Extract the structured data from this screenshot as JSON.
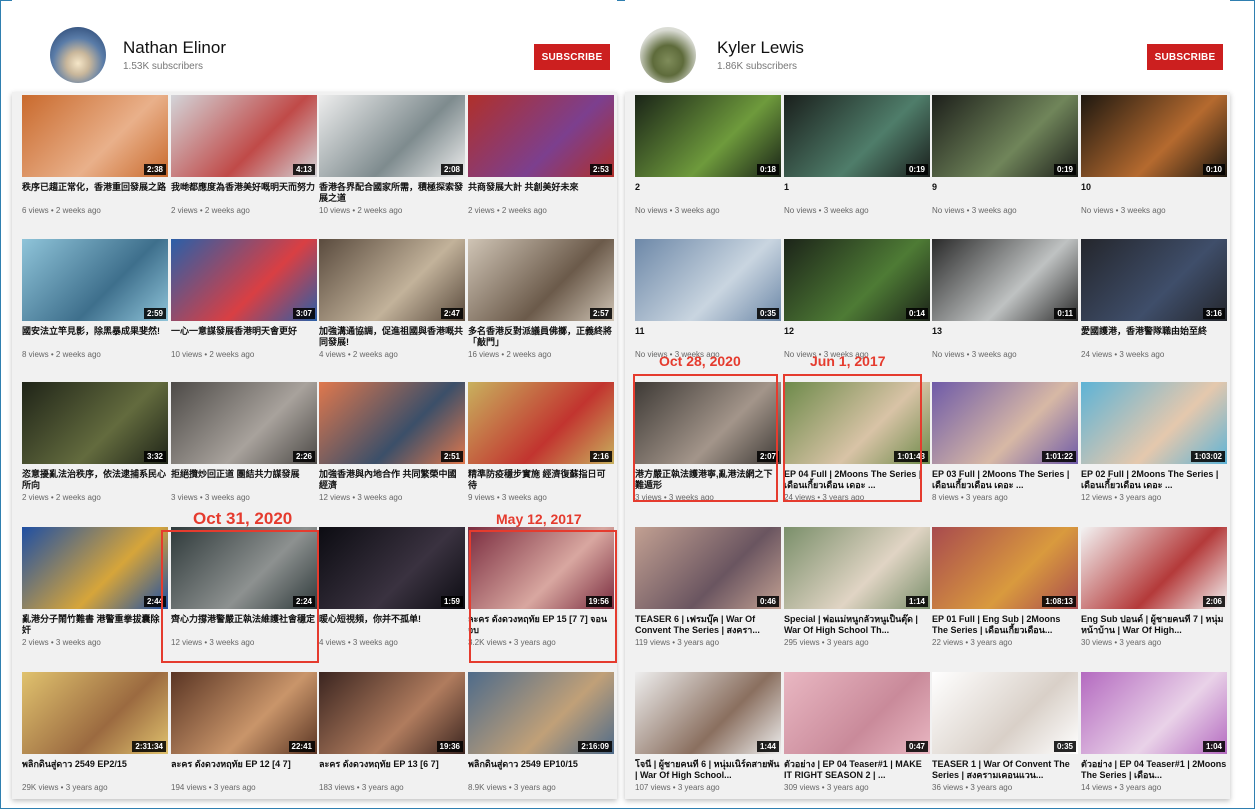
{
  "channels": [
    {
      "name": "Nathan Elinor",
      "subscribers": "1.53K subscribers",
      "subscribe_label": "SUBSCRIBE",
      "videos": [
        {
          "title": "秩序已趨正常化，香港重回發展之路",
          "meta": "6 views • 2 weeks ago",
          "duration": "2:38",
          "colors": [
            "#c96a2d",
            "#e9b08a"
          ]
        },
        {
          "title": "我哋都應度為香港美好嘅明天而努力",
          "meta": "2 views • 2 weeks ago",
          "duration": "4:13",
          "colors": [
            "#d3d4d8",
            "#c04a48"
          ]
        },
        {
          "title": "香港各界配合國家所需，積極探索發展之道",
          "meta": "10 views • 2 weeks ago",
          "duration": "2:08",
          "colors": [
            "#ededed",
            "#7e8b8e"
          ]
        },
        {
          "title": "共商發展大計 共創美好未來",
          "meta": "2 views • 2 weeks ago",
          "duration": "2:53",
          "colors": [
            "#b0302a",
            "#7c3f8e"
          ]
        },
        {
          "title": "國安法立竿見影，除黑暴成果斐然!",
          "meta": "8 views • 2 weeks ago",
          "duration": "2:59",
          "colors": [
            "#8fc4d9",
            "#3e6f8c"
          ]
        },
        {
          "title": "一心一意謀發展香港明天會更好",
          "meta": "10 views • 2 weeks ago",
          "duration": "3:07",
          "colors": [
            "#2a5fa8",
            "#d93f43"
          ]
        },
        {
          "title": "加強溝通協調，促進祖國與香港嘅共同發展!",
          "meta": "4 views • 2 weeks ago",
          "duration": "2:47",
          "colors": [
            "#5a4b3e",
            "#c2b29a"
          ]
        },
        {
          "title": "多名香港反對派議員佛擲，正義終將「敲門」",
          "meta": "16 views • 2 weeks ago",
          "duration": "2:57",
          "colors": [
            "#cfc4b5",
            "#6b5a4a"
          ]
        },
        {
          "title": "恣意擾亂法治秩序，依法逮捕系民心所向",
          "meta": "2 views • 2 weeks ago",
          "duration": "3:32",
          "colors": [
            "#1f2418",
            "#636b3e"
          ]
        },
        {
          "title": "拒絕攬炒回正道 團結共力謀發展",
          "meta": "3 views • 3 weeks ago",
          "duration": "2:26",
          "colors": [
            "#4d4a47",
            "#a8a29c"
          ]
        },
        {
          "title": "加強香港與內地合作 共同繁榮中國經濟",
          "meta": "12 views • 3 weeks ago",
          "duration": "2:51",
          "colors": [
            "#e0784d",
            "#3b4f69"
          ]
        },
        {
          "title": "精準防疫穩步實施 經濟復蘇指日可待",
          "meta": "9 views • 3 weeks ago",
          "duration": "2:16",
          "colors": [
            "#c8b15e",
            "#c2342f"
          ]
        },
        {
          "title": "亂港分子鬧竹難書 港警重拳拔囊除奸",
          "meta": "2 views • 3 weeks ago",
          "duration": "2:44",
          "colors": [
            "#1f4fa3",
            "#d6a53a"
          ]
        },
        {
          "title": "齊心力撐港警嚴正執法維護社會穩定",
          "meta": "12 views • 3 weeks ago",
          "duration": "2:24",
          "colors": [
            "#2f3a3b",
            "#8d9190"
          ]
        },
        {
          "title": "暖心短視頻，你并不孤单!",
          "meta": "4 views • 3 weeks ago",
          "duration": "1:59",
          "colors": [
            "#0c0c12",
            "#3a3240"
          ]
        },
        {
          "title": "ละคร ดั่งดวงหฤทัย EP 15 [7 7] จอนจบ",
          "meta": "3.2K views • 3 years ago",
          "duration": "19:56",
          "colors": [
            "#7a2c3f",
            "#d8a7a0"
          ]
        },
        {
          "title": "พลิกดินสู่ดาว 2549 EP2/15",
          "meta": "29K views • 3 years ago",
          "duration": "2:31:34",
          "colors": [
            "#e0c26e",
            "#9b6a40"
          ]
        },
        {
          "title": "ละคร ดั่งดวงหฤทัย EP 12 [4 7]",
          "meta": "194 views • 3 years ago",
          "duration": "22:41",
          "colors": [
            "#5a3524",
            "#c9956a"
          ]
        },
        {
          "title": "ละคร ดั่งดวงหฤทัย EP 13 [6 7]",
          "meta": "183 views • 3 years ago",
          "duration": "19:36",
          "colors": [
            "#3b2520",
            "#b07c5e"
          ]
        },
        {
          "title": "พลิกดินสู่ดาว 2549 EP10/15",
          "meta": "8.9K views • 3 years ago",
          "duration": "2:16:09",
          "colors": [
            "#4e6b8a",
            "#c0a078"
          ]
        }
      ]
    },
    {
      "name": "Kyler Lewis",
      "subscribers": "1.86K subscribers",
      "subscribe_label": "SUBSCRIBE",
      "videos": [
        {
          "title": "2",
          "meta": "No views • 3 weeks ago",
          "duration": "0:18",
          "colors": [
            "#1a2418",
            "#6e9a3c"
          ]
        },
        {
          "title": "1",
          "meta": "No views • 3 weeks ago",
          "duration": "0:19",
          "colors": [
            "#1a1f1c",
            "#4f7d6a"
          ]
        },
        {
          "title": "9",
          "meta": "No views • 3 weeks ago",
          "duration": "0:19",
          "colors": [
            "#1d1f1b",
            "#70855a"
          ]
        },
        {
          "title": "10",
          "meta": "No views • 3 weeks ago",
          "duration": "0:10",
          "colors": [
            "#1e1810",
            "#b56a2f"
          ]
        },
        {
          "title": "11",
          "meta": "No views • 3 weeks ago",
          "duration": "0:35",
          "colors": [
            "#6d88a8",
            "#c9d5e0"
          ]
        },
        {
          "title": "12",
          "meta": "No views • 3 weeks ago",
          "duration": "0:14",
          "colors": [
            "#1c2419",
            "#4e7b35"
          ]
        },
        {
          "title": "13",
          "meta": "No views • 3 weeks ago",
          "duration": "0:11",
          "colors": [
            "#2a2a2a",
            "#bfc2c2"
          ]
        },
        {
          "title": "愛國護港，香港警隊職由始至終",
          "meta": "24 views • 3 weeks ago",
          "duration": "3:16",
          "colors": [
            "#24262c",
            "#3f4e6a"
          ]
        },
        {
          "title": "港方嚴正執法護港寧,亂港法網之下難遁形",
          "meta": "3 views • 3 weeks ago",
          "duration": "2:07",
          "colors": [
            "#3e3a36",
            "#a3958a"
          ]
        },
        {
          "title": "EP 04 Full | 2Moons The Series | เดือนเกี้ยวเดือน เดอะ ...",
          "meta": "24 views • 3 years ago",
          "duration": "1:01:43",
          "colors": [
            "#6d8a4a",
            "#d8c3a6"
          ]
        },
        {
          "title": "EP 03 Full | 2Moons The Series | เดือนเกี้ยวเดือน เดอะ ...",
          "meta": "8 views • 3 years ago",
          "duration": "1:01:22",
          "colors": [
            "#6e5aa8",
            "#d7b8a5"
          ]
        },
        {
          "title": "EP 02 Full | 2Moons The Series | เดือนเกี้ยวเดือน เดอะ ...",
          "meta": "12 views • 3 years ago",
          "duration": "1:03:02",
          "colors": [
            "#5db3d6",
            "#e5c8ad"
          ]
        },
        {
          "title": "TEASER 6 | เฟรมบุ๊ค | War Of Convent The Series | สงครา...",
          "meta": "119 views • 3 years ago",
          "duration": "0:46",
          "colors": [
            "#c2a092",
            "#6a5560"
          ]
        },
        {
          "title": "Special | พ่อแม่หนูกลัวหนูเป็นตุ๊ด | War Of High School Th...",
          "meta": "295 views • 3 years ago",
          "duration": "1:14",
          "colors": [
            "#7a8f6a",
            "#e0d4c4"
          ]
        },
        {
          "title": "EP 01 Full | Eng Sub | 2Moons The Series | เดือนเกี้ยวเดือน...",
          "meta": "22 views • 3 years ago",
          "duration": "1:08:13",
          "colors": [
            "#a84a4e",
            "#d99a3e"
          ]
        },
        {
          "title": "Eng Sub ปอนด์ | ผู้ชายคนที่ 7 | หนุ่มหน้าบ้าน | War Of High...",
          "meta": "30 views • 3 years ago",
          "duration": "2:06",
          "colors": [
            "#f3f3f3",
            "#b43a3a"
          ]
        },
        {
          "title": "โจนี่ | ผู้ชายคนที่ 6 | หนุ่มเนิร์ดสายพัน | War Of High School...",
          "meta": "107 views • 3 years ago",
          "duration": "1:44",
          "colors": [
            "#eeeeee",
            "#8a6f5f"
          ]
        },
        {
          "title": "ตัวอย่าง | EP 04 Teaser#1 | MAKE IT RIGHT SEASON 2 | ...",
          "meta": "309 views • 3 years ago",
          "duration": "0:47",
          "colors": [
            "#e9b7c2",
            "#c98a9a"
          ]
        },
        {
          "title": "TEASER 1 | War Of Convent The Series | สงครามเคอนแวน...",
          "meta": "36 views • 3 years ago",
          "duration": "0:35",
          "colors": [
            "#ffffff",
            "#d9d0c8"
          ]
        },
        {
          "title": "ตัวอย่าง | EP 04 Teaser#1 | 2Moons The Series | เดือน...",
          "meta": "14 views • 3 years ago",
          "duration": "1:04",
          "colors": [
            "#b46ac0",
            "#e9d2e8"
          ]
        }
      ]
    }
  ],
  "annotations": [
    {
      "text": "Oct 31, 2020"
    },
    {
      "text": "May 12, 2017"
    },
    {
      "text": "Oct 28, 2020"
    },
    {
      "text": "Jun 1, 2017"
    }
  ],
  "accent_color": "#e53b2e"
}
